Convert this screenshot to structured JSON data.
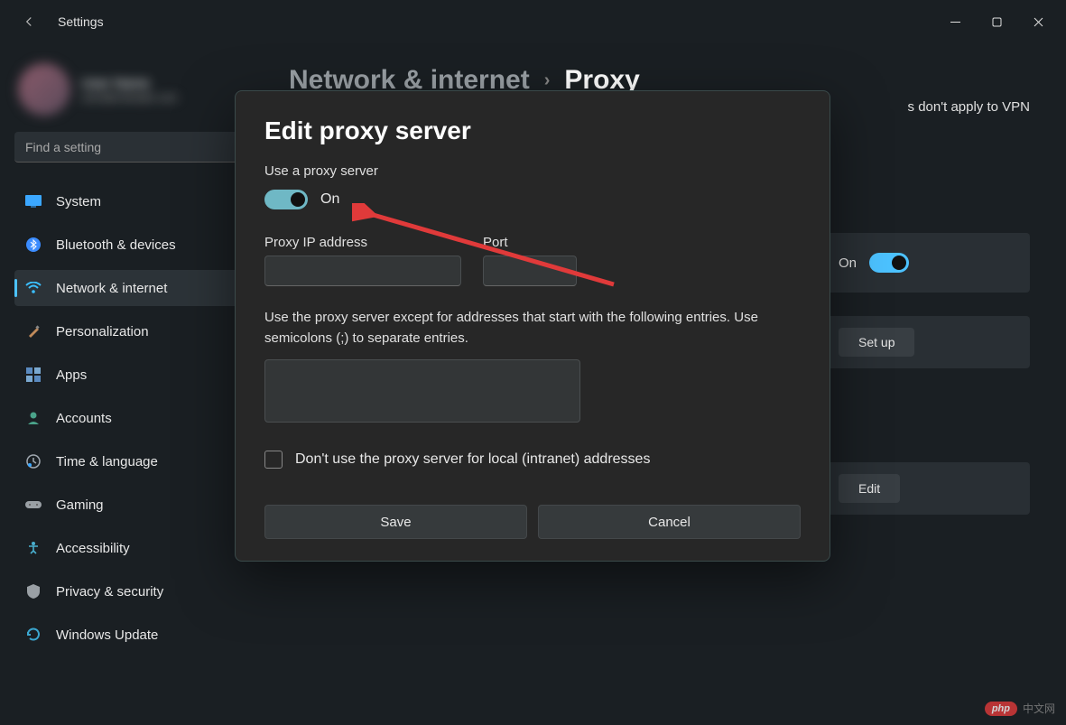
{
  "titlebar": {
    "title": "Settings"
  },
  "user": {
    "name": "User Name",
    "email": "user@example.com"
  },
  "search": {
    "placeholder": "Find a setting"
  },
  "sidebar": {
    "items": [
      {
        "label": "System",
        "icon": "monitor"
      },
      {
        "label": "Bluetooth & devices",
        "icon": "bluetooth"
      },
      {
        "label": "Network & internet",
        "icon": "wifi",
        "active": true
      },
      {
        "label": "Personalization",
        "icon": "brush"
      },
      {
        "label": "Apps",
        "icon": "apps"
      },
      {
        "label": "Accounts",
        "icon": "person"
      },
      {
        "label": "Time & language",
        "icon": "clock"
      },
      {
        "label": "Gaming",
        "icon": "gamepad"
      },
      {
        "label": "Accessibility",
        "icon": "accessibility"
      },
      {
        "label": "Privacy & security",
        "icon": "shield"
      },
      {
        "label": "Windows Update",
        "icon": "update"
      }
    ]
  },
  "breadcrumb": {
    "parent": "Network & internet",
    "current": "Proxy"
  },
  "behind": {
    "partial_text": "s don't apply to VPN",
    "row1_label": "On",
    "row2_label": "Set up",
    "row3_label": "Edit"
  },
  "dialog": {
    "title": "Edit proxy server",
    "use_proxy_label": "Use a proxy server",
    "toggle_label": "On",
    "ip_label": "Proxy IP address",
    "ip_value": "",
    "port_label": "Port",
    "port_value": "",
    "exceptions_help": "Use the proxy server except for addresses that start with the following entries. Use semicolons (;) to separate entries.",
    "exceptions_value": "",
    "local_checkbox_label": "Don't use the proxy server for local (intranet) addresses",
    "save_label": "Save",
    "cancel_label": "Cancel"
  },
  "watermark": {
    "badge": "php",
    "text": "中文网"
  },
  "icons": {
    "monitor": "#3ba7ff",
    "bluetooth": "#3b8cff",
    "wifi": "#3bbfff",
    "brush": "#c08a5a",
    "apps": "#5a8ac0",
    "person": "#4aa38a",
    "clock": "#a0a8b0",
    "gamepad": "#9aa0a5",
    "accessibility": "#4ab0d0",
    "shield": "#9aa0a5",
    "update": "#3ba7d0"
  }
}
